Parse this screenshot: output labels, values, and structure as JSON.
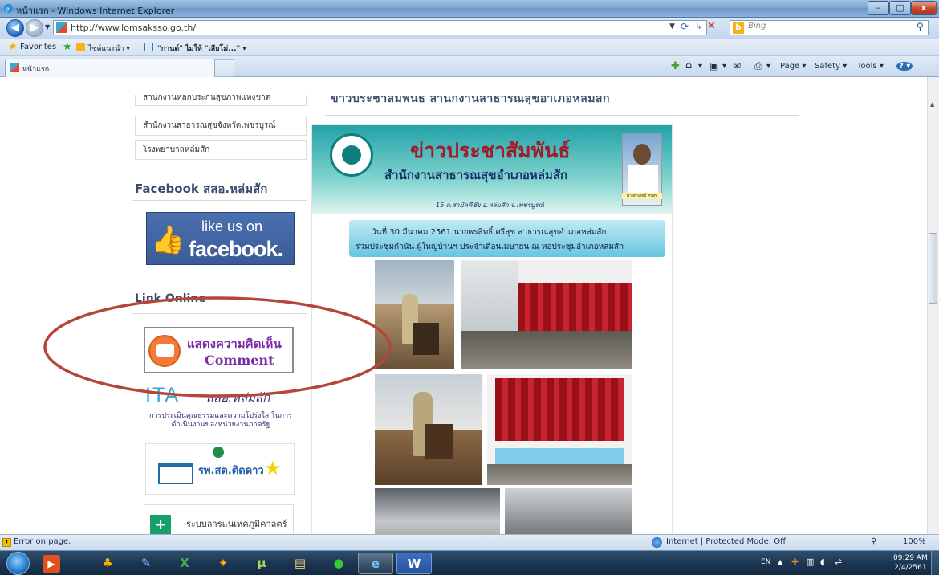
{
  "window": {
    "title": "หน้าแรก - Windows Internet Explorer",
    "buttons": {
      "minimize": "–",
      "maximize": "□",
      "close": "x"
    }
  },
  "address": {
    "url": "http://www.lomsaksso.go.th/",
    "search_placeholder": "Bing",
    "search_engine": "b"
  },
  "favorites": {
    "label": "Favorites",
    "items": [
      "ไซต์แนะนำ ▾",
      "\"กานต์\" ไม่ให้ \"เสียโม่...\" ▾"
    ]
  },
  "tab": {
    "label": "หน้าแรก"
  },
  "commands": {
    "page": "Page ▾",
    "safety": "Safety ▾",
    "tools": "Tools ▾",
    "help": "? ▾"
  },
  "sidebar": {
    "links": [
      "สำนักงานหลักประกันสุขภาพแห่งชาติ",
      "สำนักงานสาธารณสุขจังหวัดเพชรบูรณ์",
      "โรงพยาบาลหล่มสัก"
    ],
    "facebook_heading": "Facebook สสอ.หล่มสัก",
    "facebook_banner": {
      "line1": "like us on",
      "line2": "facebook."
    },
    "links_heading": "Link Online",
    "comment_banner": {
      "thai": "แสดงความคิดเห็น",
      "en": "Comment"
    },
    "ita_banner": {
      "logo": "ITA",
      "name": "สสอ.หล่มสัก",
      "subtitle": "การประเมินคุณธรรมและความโปร่งใส ในการดำเนินงานของหน่วยงานภาครัฐ"
    },
    "rpst_banner": {
      "text": "รพ.สต.ติดดาว"
    },
    "hdc_banner": {
      "text": "ระบบลารแนเหคภูมิคาลตร์"
    }
  },
  "main": {
    "news_title": "ข่าวประชาสัมพันธ์ สำนักงานสาธารณสุขอำเภอหล่มสัก",
    "poster": {
      "title": "ข่าวประชาสัมพันธ์",
      "subtitle": "สำนักงานสาธารณสุขอำเภอหล่มสัก",
      "address": "15 ถ.สามัคคีชัย อ.หล่มสัก จ.เพชรบูรณ์",
      "portrait_caption": "นายพรสิทธิ์ ศรีสุข",
      "caption_line1": "วันที่ 30 มีนาคม 2561  นายพรสิทธิ์ ศรีสุข  สาธารณสุขอำเภอหล่มสัก",
      "caption_line2": "ร่วมประชุมกำนัน ผู้ใหญ่บ้านฯ ประจำเดือนเมษายน  ณ หอประชุมอำเภอหล่มสัก"
    }
  },
  "status": {
    "message": "Error on page.",
    "zone": "Internet | Protected Mode: Off",
    "zoom": "100%"
  },
  "taskbar": {
    "language": "EN",
    "time": "09:29 AM",
    "date": "2/4/2561"
  },
  "colors": {
    "facebook": "#3b5998",
    "annotation_ellipse": "#b4463e",
    "poster_title": "#a11a2a",
    "ie_frame": "#8db5dc"
  }
}
